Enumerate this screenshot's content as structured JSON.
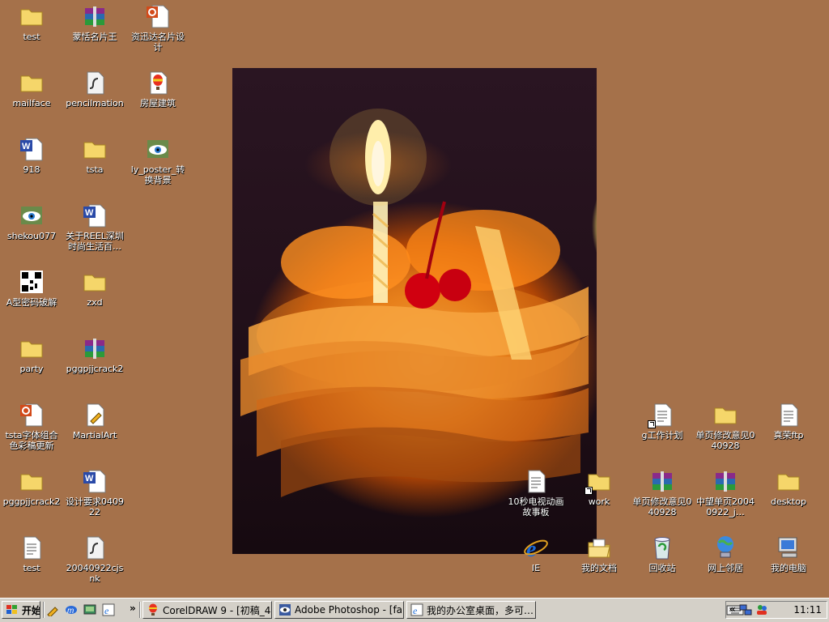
{
  "desktop": {
    "icons": [
      {
        "label": "test"
      },
      {
        "label": "蒙恬名片王"
      },
      {
        "label": "资迅达名片设计"
      },
      {
        "label": "mailface"
      },
      {
        "label": "pencilmation"
      },
      {
        "label": "房屋建筑"
      },
      {
        "label": "918"
      },
      {
        "label": "tsta"
      },
      {
        "label": "ly_poster_转换背景"
      },
      {
        "label": "shekou077"
      },
      {
        "label": "关于REEL深圳时尚生活百…"
      },
      {
        "label": "A型密码破解"
      },
      {
        "label": "zxd"
      },
      {
        "label": "party"
      },
      {
        "label": "pggpjjcrack2"
      },
      {
        "label": "tsta字体组合色彩稿更新"
      },
      {
        "label": "MartialArt"
      },
      {
        "label": "pggpjjcrack2"
      },
      {
        "label": "设计要求040922"
      },
      {
        "label": "test"
      },
      {
        "label": "20040922cjsnk"
      },
      {
        "label": "g工作计划"
      },
      {
        "label": "单页修改意见040928"
      },
      {
        "label": "真荣ftp"
      },
      {
        "label": "10秒电视动画故事板"
      },
      {
        "label": "work"
      },
      {
        "label": "单页修改意见040928"
      },
      {
        "label": "中望单页20040922_j…"
      },
      {
        "label": "desktop"
      },
      {
        "label": "IE"
      },
      {
        "label": "我的文档"
      },
      {
        "label": "回收站"
      },
      {
        "label": "网上邻居"
      },
      {
        "label": "我的电脑"
      }
    ]
  },
  "taskbar": {
    "start_label": "开始",
    "tasks": [
      {
        "label": "CorelDRAW 9 - [初稿_4]"
      },
      {
        "label": "Adobe Photoshop - [fami…"
      },
      {
        "label": "我的办公室桌面，多可…"
      }
    ],
    "overflow_label": "»",
    "tray_overflow_label": "«",
    "clock": "11:11"
  },
  "colors": {
    "desktop_bg": "#A5714A",
    "taskbar_bg": "#D4D0C8"
  }
}
